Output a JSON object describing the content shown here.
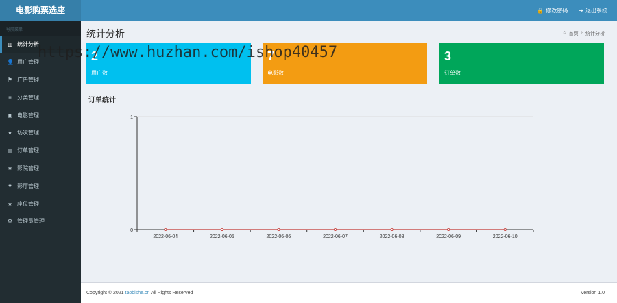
{
  "app": {
    "title": "电影购票选座"
  },
  "header": {
    "change_password": "修改密码",
    "logout": "退出系统",
    "lock_icon": "🔒",
    "logout_icon": "⇥"
  },
  "sidebar": {
    "header": "导航菜单",
    "items": [
      {
        "label": "统计分析",
        "icon": "▥",
        "active": true
      },
      {
        "label": "用户管理",
        "icon": "👤"
      },
      {
        "label": "广告管理",
        "icon": "⚑"
      },
      {
        "label": "分类管理",
        "icon": "≡"
      },
      {
        "label": "电影管理",
        "icon": "▣"
      },
      {
        "label": "场次管理",
        "icon": "★"
      },
      {
        "label": "订单管理",
        "icon": "▤"
      },
      {
        "label": "影院管理",
        "icon": "★"
      },
      {
        "label": "影厅管理",
        "icon": "♥"
      },
      {
        "label": "座位管理",
        "icon": "★"
      },
      {
        "label": "管理员管理",
        "icon": "⚙"
      }
    ]
  },
  "main": {
    "title": "统计分析",
    "breadcrumb": {
      "home_icon": "⌂",
      "home": "首页",
      "sep": "›",
      "current": "统计分析"
    },
    "boxes": [
      {
        "value": "2",
        "label": "用户数",
        "color": "#00c0ef"
      },
      {
        "value": "7",
        "label": "电影数",
        "color": "#f39c12"
      },
      {
        "value": "3",
        "label": "订单数",
        "color": "#00a65a"
      }
    ],
    "chart_title": "订单统计"
  },
  "chart_data": {
    "type": "line",
    "x": [
      "2022-06-04",
      "2022-06-05",
      "2022-06-06",
      "2022-06-07",
      "2022-06-08",
      "2022-06-09",
      "2022-06-10"
    ],
    "series": [
      {
        "values": [
          0,
          0,
          0,
          0,
          0,
          0,
          0
        ]
      }
    ],
    "yticks": [
      "0",
      "1"
    ],
    "ylim": [
      0,
      1
    ],
    "line_color": "#c23531"
  },
  "footer": {
    "copyright_prefix": "Copyright © 2021",
    "link": "taobishe.cn",
    "copyright_suffix": "All Rights Reserved",
    "version": "Version 1.0"
  },
  "watermark": "https://www.huzhan.com/ishop40457"
}
